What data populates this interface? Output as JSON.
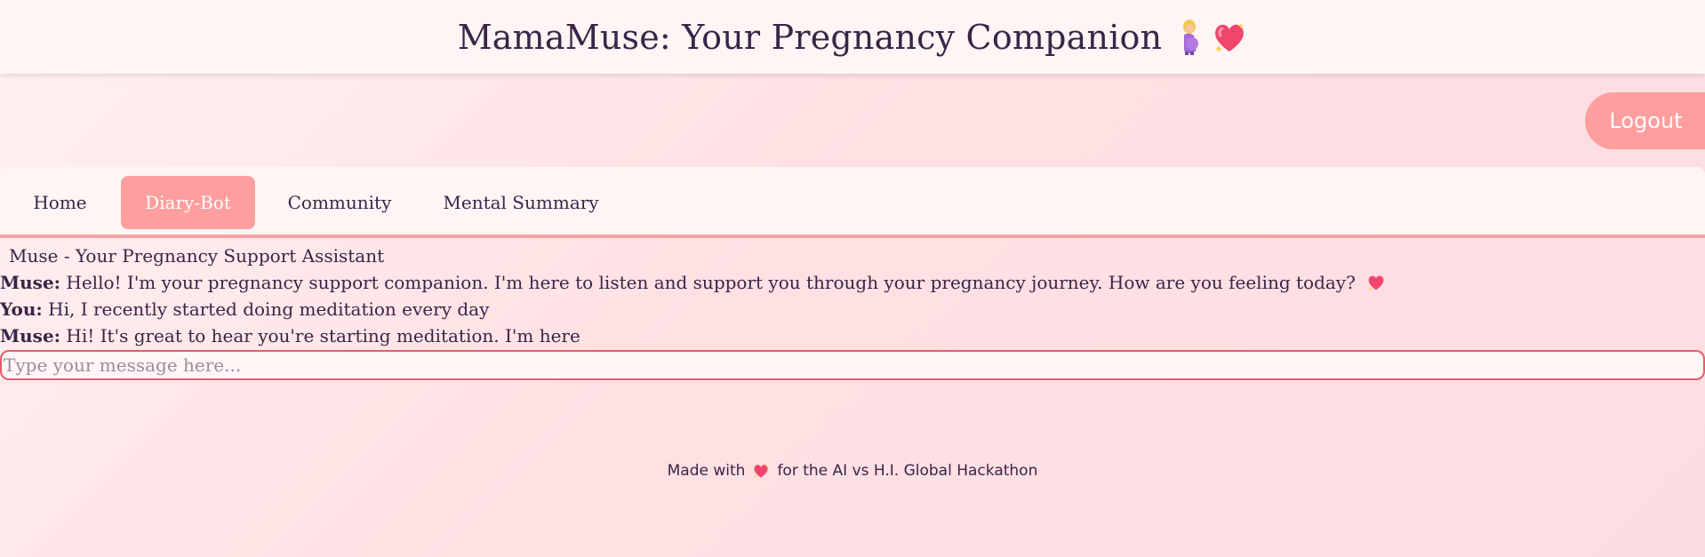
{
  "header": {
    "title": "MamaMuse: Your Pregnancy Companion",
    "emoji_1": "pregnant-woman-emoji",
    "emoji_2": "sparkling-heart-emoji"
  },
  "auth": {
    "logout_label": "Logout"
  },
  "nav": {
    "items": [
      {
        "label": "Home",
        "active": false
      },
      {
        "label": "Diary-Bot",
        "active": true
      },
      {
        "label": "Community",
        "active": false
      },
      {
        "label": "Mental Summary",
        "active": false
      }
    ]
  },
  "chat": {
    "title": "Muse - Your Pregnancy Support Assistant",
    "messages": [
      {
        "sender": "Muse:",
        "text": "Hello! I'm your pregnancy support companion. I'm here to listen and support you through your pregnancy journey. How are you feeling today?",
        "emoji": "sparkling-heart-emoji"
      },
      {
        "sender": "You:",
        "text": "Hi, I recently started doing meditation every day"
      },
      {
        "sender": "Muse:",
        "text": "Hi! It's great to hear you're starting meditation. I'm here"
      }
    ],
    "input_placeholder": "Type your message here...",
    "input_value": ""
  },
  "footer": {
    "text_before": "Made with",
    "emoji": "sparkling-heart-emoji",
    "text_after": "for the AI vs H.I. Global Hackathon"
  },
  "colors": {
    "accent": "#ff9e9e",
    "input_border": "#e85d6c",
    "text": "#3a2548",
    "panel": "#fff5f5"
  }
}
